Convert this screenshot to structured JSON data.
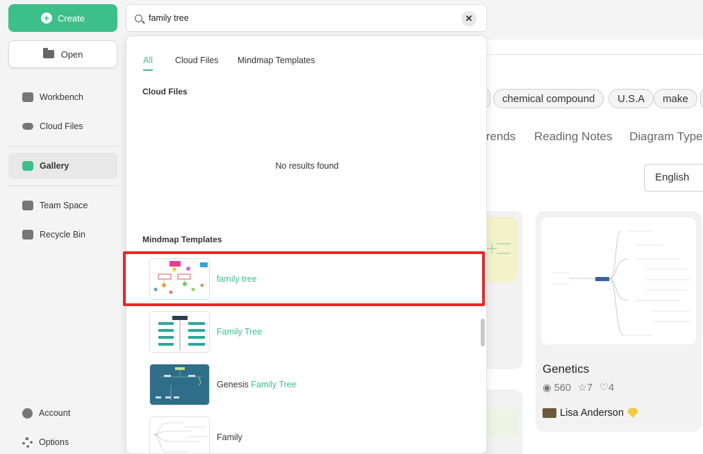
{
  "sidebar": {
    "create_label": "Create",
    "open_label": "Open",
    "items": [
      {
        "label": "Workbench",
        "icon": "workbench-icon"
      },
      {
        "label": "Cloud Files",
        "icon": "cloud-icon"
      },
      {
        "label": "Gallery",
        "icon": "gallery-icon"
      },
      {
        "label": "Team Space",
        "icon": "team-icon"
      },
      {
        "label": "Recycle Bin",
        "icon": "trash-icon"
      },
      {
        "label": "Account",
        "icon": "user-icon"
      },
      {
        "label": "Options",
        "icon": "gear-icon"
      }
    ],
    "accent": "#3cbf8a"
  },
  "search": {
    "value": "family tree"
  },
  "dropdown": {
    "tabs": [
      "All",
      "Cloud Files",
      "Mindmap Templates"
    ],
    "active_tab": "All",
    "cloud_section_title": "Cloud Files",
    "no_results": "No results found",
    "templates_section_title": "Mindmap Templates",
    "templates": [
      {
        "prefix": "",
        "match": "family tree",
        "suffix": ""
      },
      {
        "prefix": "",
        "match": "Family Tree",
        "suffix": ""
      },
      {
        "prefix": "Genesis ",
        "match": "Family Tree",
        "suffix": ""
      },
      {
        "prefix": "Family",
        "match": "",
        "suffix": ""
      }
    ],
    "highlight_color": "#e02a2a"
  },
  "background": {
    "tags": [
      "chemical compound",
      "U.S.A",
      "make"
    ],
    "category_tabs": [
      "Trends",
      "Reading Notes",
      "Diagram Type"
    ],
    "language": "English",
    "card": {
      "title": "Genetics",
      "views": "560",
      "stars": "7",
      "likes": "4",
      "author": "Lisa Anderson"
    }
  }
}
